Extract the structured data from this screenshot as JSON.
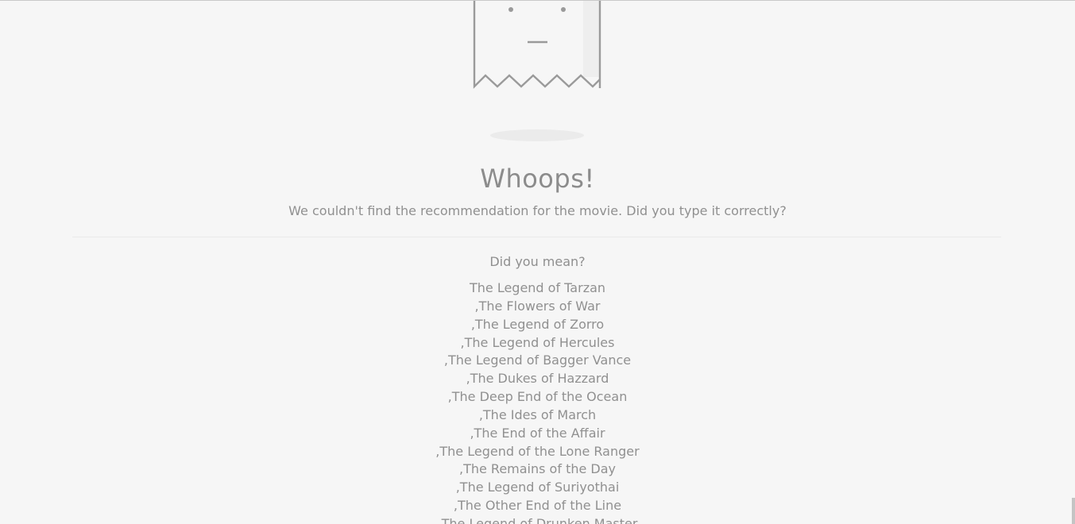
{
  "colors": {
    "background": "#f6f6f6",
    "text": "#8f8f8f",
    "illustration_stroke": "#9a9a9a"
  },
  "illustration": {
    "icon": "sad-receipt-icon"
  },
  "error": {
    "title": "Whoops!",
    "message": "We couldn't find the recommendation for the movie. Did you type it correctly?"
  },
  "suggestions": {
    "heading": "Did you mean?",
    "items": [
      "The Legend of Tarzan",
      ",The Flowers of War",
      ",The Legend of Zorro",
      ",The Legend of Hercules",
      ",The Legend of Bagger Vance",
      ",The Dukes of Hazzard",
      ",The Deep End of the Ocean",
      ",The Ides of March",
      ",The End of the Affair",
      ",The Legend of the Lone Ranger",
      ",The Remains of the Day",
      ",The Legend of Suriyothai",
      ",The Other End of the Line",
      ",The Legend of Drunken Master"
    ]
  }
}
